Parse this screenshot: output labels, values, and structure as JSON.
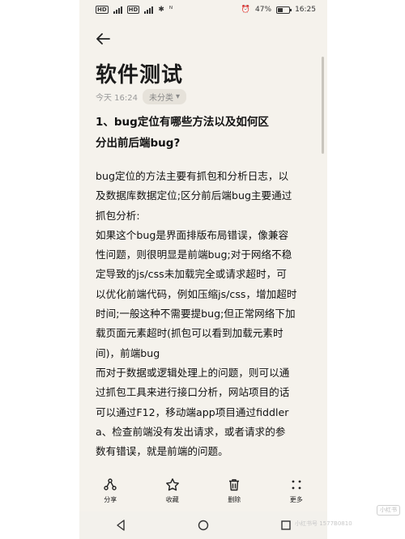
{
  "status_bar": {
    "left_text": "HD",
    "right_battery": "47%",
    "time": "16:25",
    "battery_level": 0.47
  },
  "note": {
    "title": "软件测试",
    "date": "今天 16:24",
    "category": "未分类",
    "heading_lines": [
      "1、bug定位有哪些方法以及如何区",
      "分出前后端bug?"
    ],
    "body_lines": [
      "bug定位的方法主要有抓包和分析日志，以",
      "及数据库数据定位;区分前后端bug主要通过",
      "抓包分析:",
      "如果这个bug是界面排版布局错误，像兼容",
      "性问题，则很明显是前端bug;对于网络不稳",
      "定导致的js/css未加载完全或请求超时，可",
      "以优化前端代码，例如压缩js/css，增加超时",
      "时间;一般这种不需要提bug;但正常网络下加",
      "载页面元素超时(抓包可以看到加载元素时",
      "间)，前端bug",
      "而对于数据或逻辑处理上的问题，则可以通",
      "过抓包工具来进行接口分析，网站项目的话",
      "可以通过F12，移动端app项目通过fiddler",
      "a、检查前端没有发出请求，或者请求的参",
      "数有错误，就是前端的问题。"
    ]
  },
  "toolbar": {
    "share": "分享",
    "favorite": "收藏",
    "delete": "删除",
    "more": "更多"
  },
  "watermark": {
    "badge": "小红书",
    "text": "小红书号 1577B0810"
  }
}
